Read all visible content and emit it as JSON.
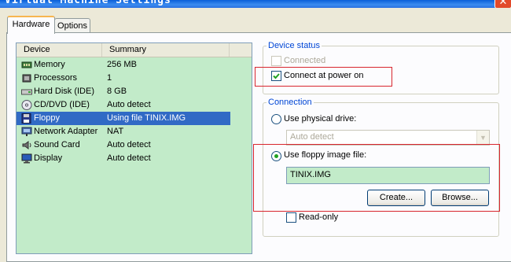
{
  "window": {
    "title": "Virtual Machine Settings",
    "close_glyph": "✕"
  },
  "tabs": [
    "Hardware",
    "Options"
  ],
  "device_list": {
    "columns": [
      "Device",
      "Summary"
    ],
    "rows": [
      {
        "icon": "memory-icon",
        "name": "Memory",
        "summary": "256 MB"
      },
      {
        "icon": "processor-icon",
        "name": "Processors",
        "summary": "1"
      },
      {
        "icon": "hard-disk-icon",
        "name": "Hard Disk (IDE)",
        "summary": "8 GB"
      },
      {
        "icon": "cd-dvd-icon",
        "name": "CD/DVD (IDE)",
        "summary": "Auto detect"
      },
      {
        "icon": "floppy-icon",
        "name": "Floppy",
        "summary": "Using file TINIX.IMG",
        "selected": true
      },
      {
        "icon": "network-adapter-icon",
        "name": "Network Adapter",
        "summary": "NAT"
      },
      {
        "icon": "sound-card-icon",
        "name": "Sound Card",
        "summary": "Auto detect"
      },
      {
        "icon": "display-icon",
        "name": "Display",
        "summary": "Auto detect"
      }
    ]
  },
  "device_status": {
    "title": "Device status",
    "connected_label": "Connected",
    "connected_checked": false,
    "connect_power_on_label": "Connect at power on",
    "connect_power_on_checked": true
  },
  "connection": {
    "title": "Connection",
    "physical_label": "Use physical drive:",
    "physical_value": "Auto detect",
    "image_label": "Use floppy image file:",
    "image_value": "TINIX.IMG",
    "selected": "image",
    "create_label": "Create...",
    "browse_label": "Browse...",
    "readonly_label": "Read-only",
    "readonly_checked": false
  },
  "colors": {
    "selection": "#316ac5",
    "list_bg": "#c2ebc9",
    "group_title": "#0046d5",
    "highlight_box": "#d8262e"
  }
}
